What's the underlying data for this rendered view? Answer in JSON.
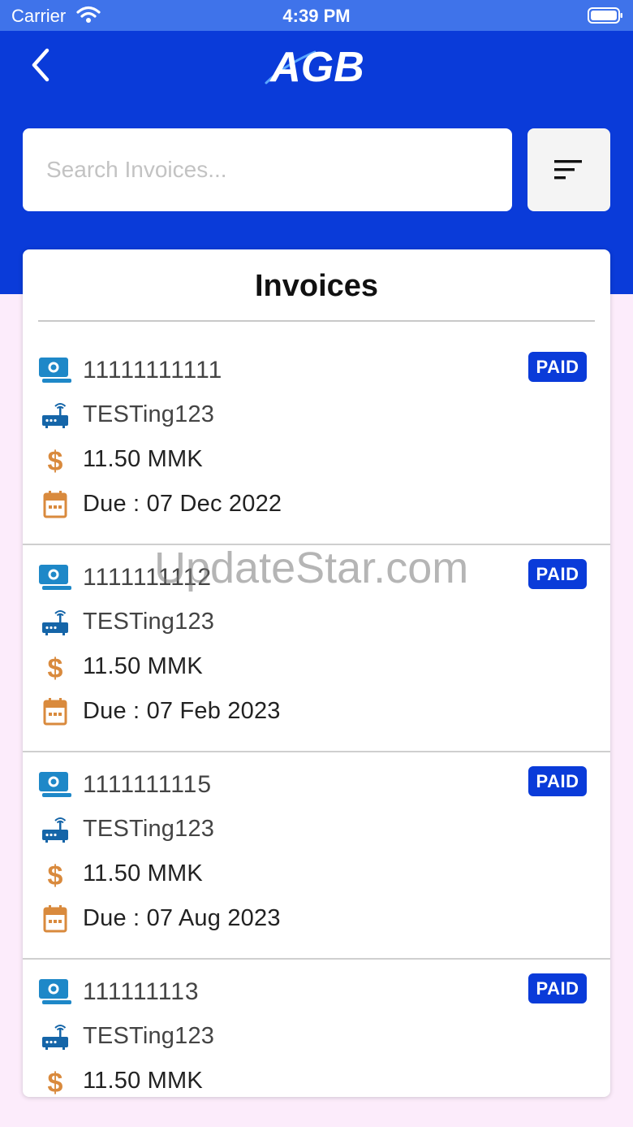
{
  "status_bar": {
    "carrier": "Carrier",
    "time": "4:39 PM"
  },
  "header": {
    "logo_text": "AGB",
    "back_icon": "chevron-left-icon"
  },
  "search": {
    "placeholder": "Search Invoices..."
  },
  "filter": {
    "icon": "sort-filter-icon"
  },
  "card": {
    "title": "Invoices"
  },
  "invoices": [
    {
      "number": "11111111111",
      "network": "TESTing123",
      "amount": "11.50 MMK",
      "due": "Due : 07 Dec 2022",
      "status": "PAID"
    },
    {
      "number": "1111111112",
      "network": "TESTing123",
      "amount": "11.50 MMK",
      "due": "Due : 07 Feb 2023",
      "status": "PAID"
    },
    {
      "number": "1111111115",
      "network": "TESTing123",
      "amount": "11.50 MMK",
      "due": "Due : 07 Aug 2023",
      "status": "PAID"
    },
    {
      "number": "111111113",
      "network": "TESTing123",
      "amount": "11.50 MMK",
      "status": "PAID"
    }
  ],
  "watermark": "UpdateStar.com",
  "colors": {
    "brand_blue": "#0a3bd9",
    "status_bar_blue": "#3f73ea",
    "background_pink": "#fcecfb",
    "icon_orange": "#d98a3d",
    "icon_blue": "#1e88c8"
  }
}
